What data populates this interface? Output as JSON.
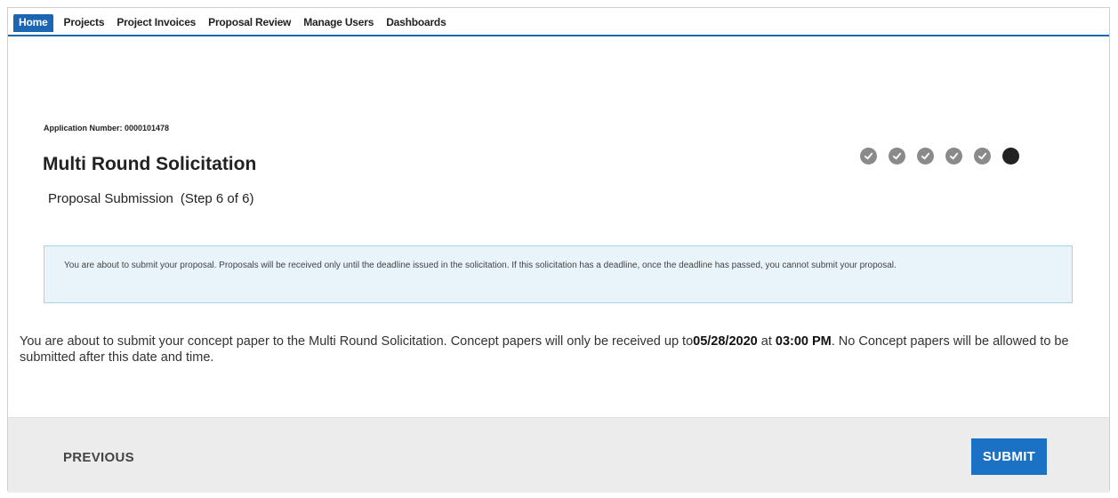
{
  "nav": {
    "items": [
      {
        "label": "Home",
        "active": true
      },
      {
        "label": "Projects"
      },
      {
        "label": "Project Invoices"
      },
      {
        "label": "Proposal Review"
      },
      {
        "label": "Manage Users"
      },
      {
        "label": "Dashboards"
      }
    ]
  },
  "application": {
    "number_label": "Application Number: 0000101478"
  },
  "page": {
    "title": "Multi Round Solicitation",
    "step_name": "Proposal Submission",
    "step_count": "(Step 6 of 6)"
  },
  "progress": {
    "completed_steps": 5,
    "total_steps": 6,
    "completed_color": "#8a8a8a",
    "current_color": "#222222"
  },
  "info_box": {
    "text": "You are about to submit your proposal. Proposals will be received only until the deadline issued in the solicitation. If this solicitation has a deadline, once the deadline has passed, you cannot submit your proposal."
  },
  "concept": {
    "text_before": "You are about to submit your concept paper to the Multi Round Solicitation. Concept papers will only be received up to",
    "date": "05/28/2020",
    "at_word": "at",
    "time": "03:00 PM",
    "text_after": ".   No Concept papers will be allowed to be submitted after this date and time."
  },
  "footer": {
    "previous_label": "PREVIOUS",
    "submit_label": "SUBMIT"
  },
  "colors": {
    "accent": "#1a66b3",
    "submit": "#1b72c4",
    "info_bg": "#e8f3fa",
    "info_border": "#a9d3ec"
  }
}
